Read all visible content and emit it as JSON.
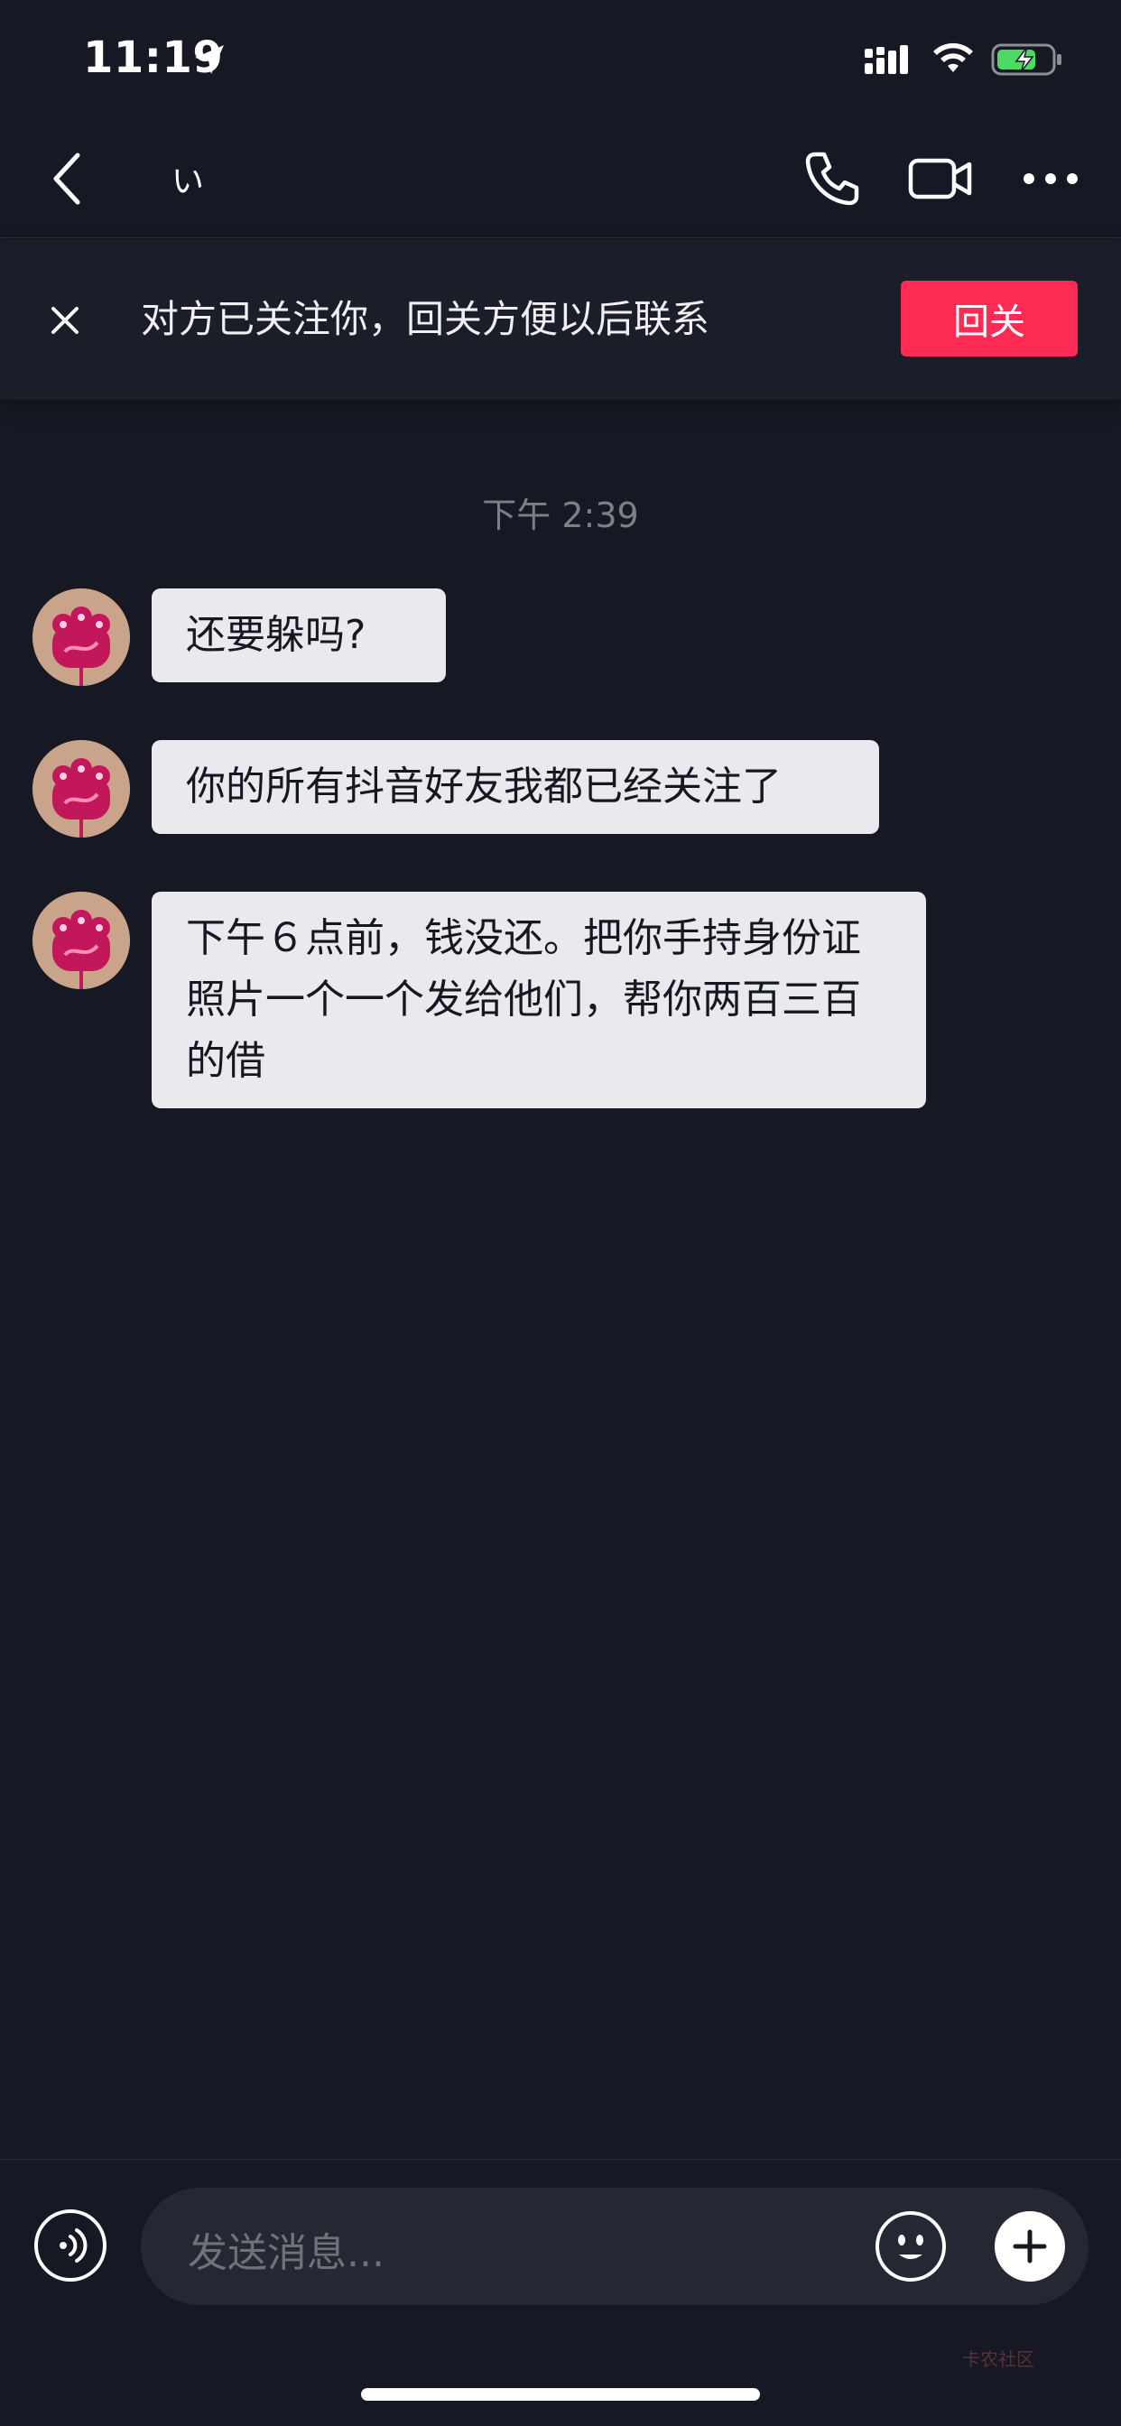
{
  "status_bar": {
    "time": "11:19",
    "icons": [
      "location-arrow-icon",
      "cellular-signal-icon",
      "wifi-icon",
      "battery-charging-icon"
    ],
    "battery_color": "#4cd964"
  },
  "header": {
    "chat_name": "い",
    "icons": [
      "back-chevron-icon",
      "phone-icon",
      "video-camera-icon",
      "more-dots-icon"
    ]
  },
  "follow_banner": {
    "text": "对方已关注你，回关方便以后联系",
    "button_label": "回关",
    "button_color": "#fe2c55"
  },
  "messages": {
    "timestamp": "下午 2:39",
    "items": [
      {
        "text": "还要躲吗?"
      },
      {
        "text": "你的所有抖音好友我都已经关注了"
      },
      {
        "text": "下午６点前，钱没还。把你手持身份证照片一个一个发给他们，帮你两百三百的借"
      }
    ]
  },
  "input_bar": {
    "placeholder": "发送消息...",
    "icons": [
      "voice-icon",
      "emoji-icon",
      "plus-icon"
    ]
  },
  "watermark": "卡农社区"
}
